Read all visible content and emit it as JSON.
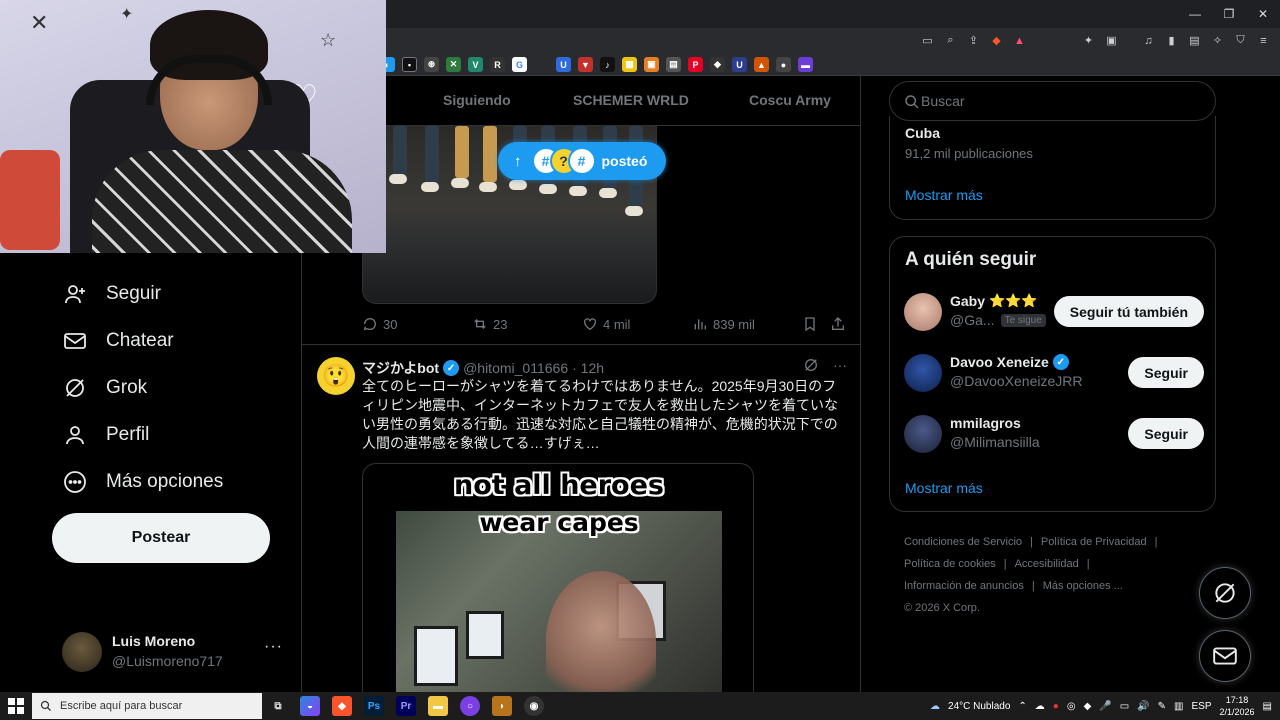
{
  "left_nav": {
    "items": [
      {
        "label": "Seguir",
        "icon": "add-user-icon"
      },
      {
        "label": "Chatear",
        "icon": "envelope-icon"
      },
      {
        "label": "Grok",
        "icon": "grok-icon"
      },
      {
        "label": "Perfil",
        "icon": "person-icon"
      },
      {
        "label": "Más opciones",
        "icon": "more-circle-icon"
      }
    ],
    "post_button": "Postear",
    "account": {
      "name": "Luis Moreno",
      "handle": "@Luismoreno717",
      "more": "···"
    }
  },
  "tabs": [
    "Siguiendo",
    "SCHEMER WRLD",
    "Coscu Army"
  ],
  "new_posts_pill": {
    "label": "posteó"
  },
  "tweet1": {
    "replies": "30",
    "reposts": "23",
    "likes": "4 mil",
    "views": "839 mil"
  },
  "tweet2": {
    "name": "マジかよbot",
    "handle": "@hitomi_011666",
    "time": "· 12h",
    "text": "全てのヒーローがシャツを着てるわけではありません。2025年9月30日のフィリピン地震中、インターネットカフェで友人を救出したシャツを着ていない男性の勇気ある行動。迅速な対応と自己犠牲の精神が、危機的状況下での人間の連帯感を象徴してる…すげぇ…",
    "media_caption_line1": "not all heroes",
    "media_caption_line2": "wear capes"
  },
  "search": {
    "placeholder": "Buscar"
  },
  "trend": {
    "title": "Cuba",
    "count": "91,2 mil publicaciones",
    "show_more": "Mostrar más"
  },
  "who_to_follow": {
    "title": "A quién seguir",
    "accounts": [
      {
        "name": "Gaby",
        "stars": "⭐⭐⭐",
        "handle": "@Ga...",
        "badge": "Te sigue",
        "button": "Seguir tú también"
      },
      {
        "name": "Davoo Xeneize",
        "handle": "@DavooXeneizeJRR",
        "button": "Seguir"
      },
      {
        "name": "mmilagros",
        "handle": "@Milimansiilla",
        "button": "Seguir"
      }
    ],
    "show_more": "Mostrar más"
  },
  "footer": {
    "links": [
      "Condiciones de Servicio",
      "Política de Privacidad",
      "Política de cookies",
      "Accesibilidad",
      "Información de anuncios",
      "Más opciones ..."
    ],
    "copyright": "© 2026 X Corp."
  },
  "taskbar": {
    "search_placeholder": "Escribe aquí para buscar",
    "weather": "24°C  Nublado",
    "lang": "ESP",
    "time": "17:18",
    "date": "2/1/2026"
  },
  "colors": {
    "accent": "#1d9bf0",
    "background": "#000000",
    "muted": "#71767b"
  }
}
